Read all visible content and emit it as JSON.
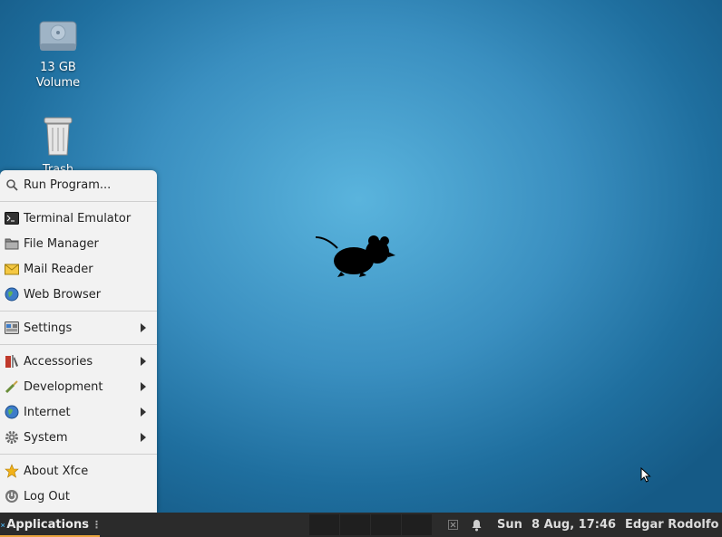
{
  "desktop": {
    "icons": [
      {
        "label_line1": "13 GB",
        "label_line2": "Volume"
      },
      {
        "label": "Trash"
      }
    ]
  },
  "menu": {
    "items": [
      {
        "label": "Run Program...",
        "icon": "search-icon"
      },
      {
        "label": "Terminal Emulator",
        "icon": "terminal-icon"
      },
      {
        "label": "File Manager",
        "icon": "folder-icon"
      },
      {
        "label": "Mail Reader",
        "icon": "mail-icon"
      },
      {
        "label": "Web Browser",
        "icon": "globe-icon"
      },
      {
        "label": "Settings",
        "icon": "settings-icon",
        "submenu": true
      },
      {
        "label": "Accessories",
        "icon": "accessories-icon",
        "submenu": true
      },
      {
        "label": "Development",
        "icon": "development-icon",
        "submenu": true
      },
      {
        "label": "Internet",
        "icon": "internet-icon",
        "submenu": true
      },
      {
        "label": "System",
        "icon": "gear-icon",
        "submenu": true
      },
      {
        "label": "About Xfce",
        "icon": "star-icon"
      },
      {
        "label": "Log Out",
        "icon": "power-icon"
      }
    ]
  },
  "taskbar": {
    "applications_label": "Applications",
    "day": "Sun",
    "datetime": "8 Aug, 17:46",
    "user": "Edgar Rodolfo",
    "accent_color": "#e8a33d"
  }
}
